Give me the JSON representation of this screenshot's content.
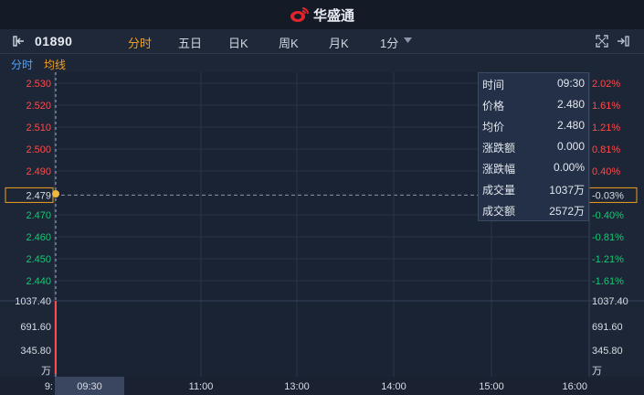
{
  "header": {
    "brand": "华盛通",
    "logo_icon": "weibo-style-logo-icon"
  },
  "toolbar": {
    "stock_code": "01890",
    "tabs": [
      {
        "label": "分时",
        "active": true
      },
      {
        "label": "五日",
        "active": false
      },
      {
        "label": "日K",
        "active": false
      },
      {
        "label": "周K",
        "active": false
      },
      {
        "label": "月K",
        "active": false
      },
      {
        "label": "1分",
        "active": false
      }
    ],
    "dropdown_icon": "caret-down-icon",
    "fullscreen_icon": "expand-icon",
    "exit_icon": "exit-icon",
    "sidebar_icon": "panel-toggle-icon"
  },
  "subbar": {
    "mode": "分时",
    "avg_label": "均线"
  },
  "left_axis": {
    "price_ticks": [
      "2.530",
      "2.520",
      "2.510",
      "2.500",
      "2.490",
      "2.479",
      "2.470",
      "2.460",
      "2.450",
      "2.440"
    ],
    "volume_ticks": [
      "1037.40",
      "691.60",
      "345.80",
      "万"
    ],
    "time_start_partial": "9:"
  },
  "right_axis": {
    "pct_ticks": [
      "2.02%",
      "1.61%",
      "1.21%",
      "0.81%",
      "0.40%",
      "-0.03%",
      "-0.40%",
      "-0.81%",
      "-1.21%",
      "-1.61%"
    ],
    "volume_ticks": [
      "1037.40",
      "691.60",
      "345.80",
      "万"
    ]
  },
  "time_axis": {
    "labels": [
      "09:30",
      "11:00",
      "13:00",
      "14:00",
      "15:00",
      "16:00"
    ]
  },
  "tooltip": {
    "rows": [
      {
        "label": "时间",
        "value": "09:30"
      },
      {
        "label": "价格",
        "value": "2.480"
      },
      {
        "label": "均价",
        "value": "2.480"
      },
      {
        "label": "涨跌额",
        "value": "0.000"
      },
      {
        "label": "涨跌幅",
        "value": "0.00%"
      },
      {
        "label": "成交量",
        "value": "1037万"
      },
      {
        "label": "成交额",
        "value": "2572万"
      }
    ]
  },
  "colors": {
    "up": "#ff4a4a",
    "down": "#14c974",
    "neutral": "#d8dde6",
    "accent": "#f0a020",
    "link": "#4ea4ff"
  },
  "chart_data": {
    "type": "line",
    "x": [
      "09:30"
    ],
    "series": [
      {
        "values": [
          2.48
        ]
      }
    ],
    "volume": [
      1037.4
    ],
    "y_price_range": [
      2.435,
      2.535
    ],
    "prev_close": 2.479,
    "time_ticks": [
      "09:30",
      "11:00",
      "13:00",
      "14:00",
      "15:00",
      "16:00"
    ]
  }
}
